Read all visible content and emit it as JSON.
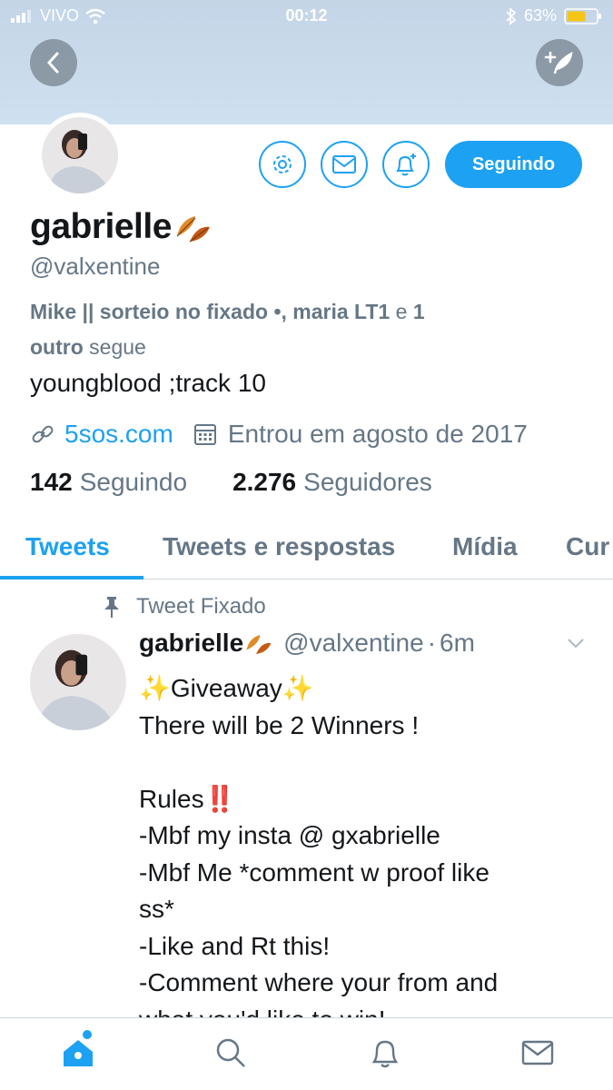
{
  "status_bar": {
    "carrier": "VIVO",
    "time": "00:12",
    "battery": "63%"
  },
  "header": {
    "back_icon": "chevron-left-icon",
    "compose_icon": "feather-plus-icon"
  },
  "profile": {
    "follow_button_label": "Seguindo",
    "name": "gabrielle",
    "name_emoji": "autumn-leaf-icon",
    "handle": "@valxentine",
    "followed_by_names": "Mike || sorteio no fixado •, maria LT1",
    "followed_by_and": "e",
    "followed_by_count": "1",
    "followed_by_other": "outro",
    "followed_by_suffix": "segue",
    "bio": "youngblood ;track 10",
    "website": "5sos.com",
    "joined": "Entrou em agosto de 2017",
    "following_count": "142",
    "following_label": "Seguindo",
    "followers_count": "2.276",
    "followers_label": "Seguidores"
  },
  "tabs": [
    {
      "label": "Tweets",
      "active": true
    },
    {
      "label": "Tweets e respostas",
      "active": false
    },
    {
      "label": "Mídia",
      "active": false
    },
    {
      "label": "Cur",
      "active": false
    }
  ],
  "pinned_tweet": {
    "pinned_label": "Tweet Fixado",
    "author_name": "gabrielle",
    "author_handle": "@valxentine",
    "separator": "·",
    "time": "6m",
    "lines": [
      "✨Giveaway✨",
      "There will be 2 Winners !",
      "",
      "Rules‼️",
      "-Mbf my insta @ gxabrielle",
      "-Mbf Me *comment w proof like",
      "ss*",
      "-Like and Rt this!",
      "-Comment where your from and",
      "what you'd like to win!"
    ]
  },
  "bottom_nav": [
    "home-icon",
    "search-icon",
    "notifications-icon",
    "messages-icon"
  ],
  "colors": {
    "accent": "#1da1f2",
    "secondary_text": "#657786",
    "header_bg": "#c8dbed"
  }
}
